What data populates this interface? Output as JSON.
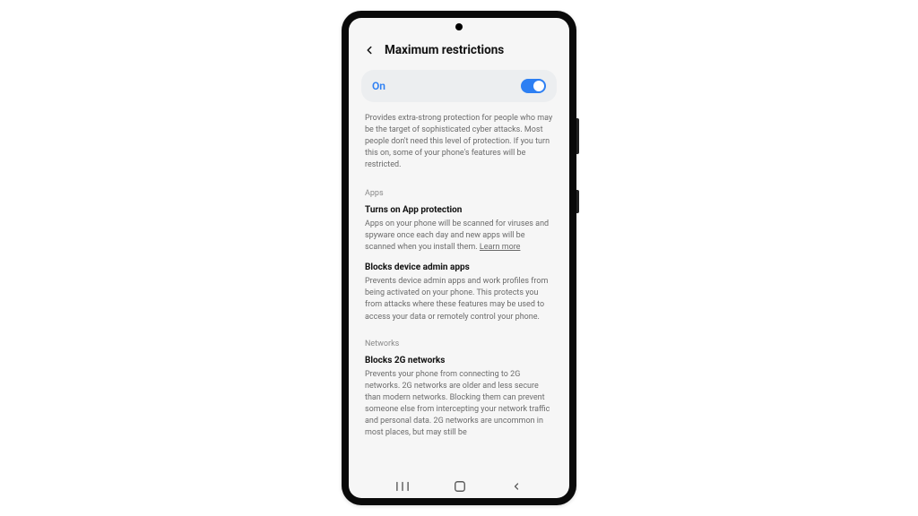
{
  "header": {
    "title": "Maximum restrictions"
  },
  "toggle": {
    "label": "On",
    "state": "on"
  },
  "intro": "Provides extra-strong protection for people who may be the target of sophisticated cyber attacks. Most people don't need this level of protection. If you turn this on, some of your phone's features will be restricted.",
  "sections": [
    {
      "label": "Apps",
      "items": [
        {
          "title": "Turns on App protection",
          "body": "Apps on your phone will be scanned for viruses and spyware once each day and new apps will be scanned when you install them.",
          "link": "Learn more"
        },
        {
          "title": "Blocks device admin apps",
          "body": "Prevents device admin apps and work profiles from being activated on your phone. This protects you from attacks where these features may be used to access your data or remotely control your phone."
        }
      ]
    },
    {
      "label": "Networks",
      "items": [
        {
          "title": "Blocks 2G networks",
          "body": "Prevents your phone from connecting to 2G networks. 2G networks are older and less secure than modern networks. Blocking them can prevent someone else from intercepting your network traffic and personal data. 2G networks are uncommon in most places, but may still be"
        }
      ]
    }
  ]
}
